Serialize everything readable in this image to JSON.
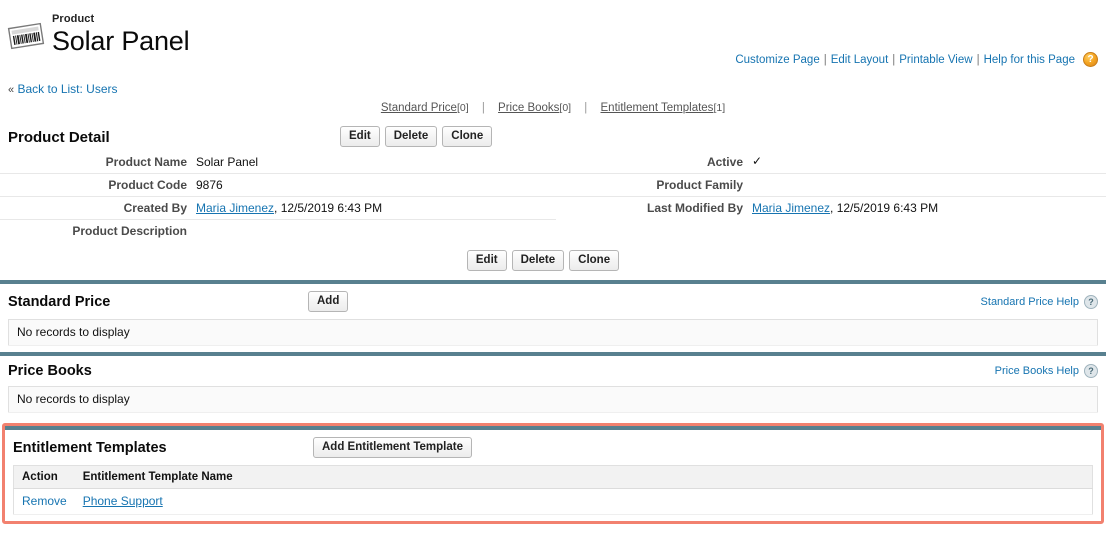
{
  "header": {
    "record_type": "Product",
    "record_title": "Solar Panel",
    "icon": "barcode-product-icon",
    "links": [
      {
        "label": "Customize Page"
      },
      {
        "label": "Edit Layout"
      },
      {
        "label": "Printable View"
      },
      {
        "label": "Help for this Page"
      }
    ],
    "separator": "|",
    "help_icon": "help-orb-icon",
    "help_glyph": "?",
    "back_link": "Back to List: Users",
    "back_chevron": "«"
  },
  "anchor_nav": {
    "items": [
      {
        "label": "Standard Price",
        "count": "[0]"
      },
      {
        "label": "Price Books",
        "count": "[0]"
      },
      {
        "label": "Entitlement Templates",
        "count": "[1]"
      }
    ],
    "separator": "|"
  },
  "product_detail": {
    "title": "Product Detail",
    "buttons": [
      {
        "label": "Edit",
        "name": "edit-button"
      },
      {
        "label": "Delete",
        "name": "delete-button"
      },
      {
        "label": "Clone",
        "name": "clone-button"
      }
    ],
    "fields": {
      "product_name_label": "Product Name",
      "product_name_value": "Solar Panel",
      "active_label": "Active",
      "active_value": "✓",
      "product_code_label": "Product Code",
      "product_code_value": "9876",
      "product_family_label": "Product Family",
      "product_family_value": "",
      "created_by_label": "Created By",
      "created_by_user": "Maria Jimenez",
      "created_by_date": ", 12/5/2019 6:43 PM",
      "last_modified_by_label": "Last Modified By",
      "last_modified_by_user": "Maria Jimenez",
      "last_modified_by_date": ", 12/5/2019 6:43 PM",
      "product_description_label": "Product Description",
      "product_description_value": ""
    }
  },
  "standard_price": {
    "title": "Standard Price",
    "add_button": "Add",
    "help_link": "Standard Price Help",
    "help_glyph": "?",
    "empty_message": "No records to display"
  },
  "price_books": {
    "title": "Price Books",
    "help_link": "Price Books Help",
    "help_glyph": "?",
    "empty_message": "No records to display"
  },
  "entitlement_templates": {
    "title": "Entitlement Templates",
    "add_button": "Add Entitlement Template",
    "columns": [
      "Action",
      "Entitlement Template Name"
    ],
    "rows": [
      {
        "action": "Remove",
        "name": "Phone Support"
      }
    ],
    "highlight_color": "#f2816f"
  },
  "colors": {
    "section_rule": "#58808f",
    "link": "#1674b1",
    "highlight": "#f2816f",
    "help_orb": "#f5a623"
  }
}
